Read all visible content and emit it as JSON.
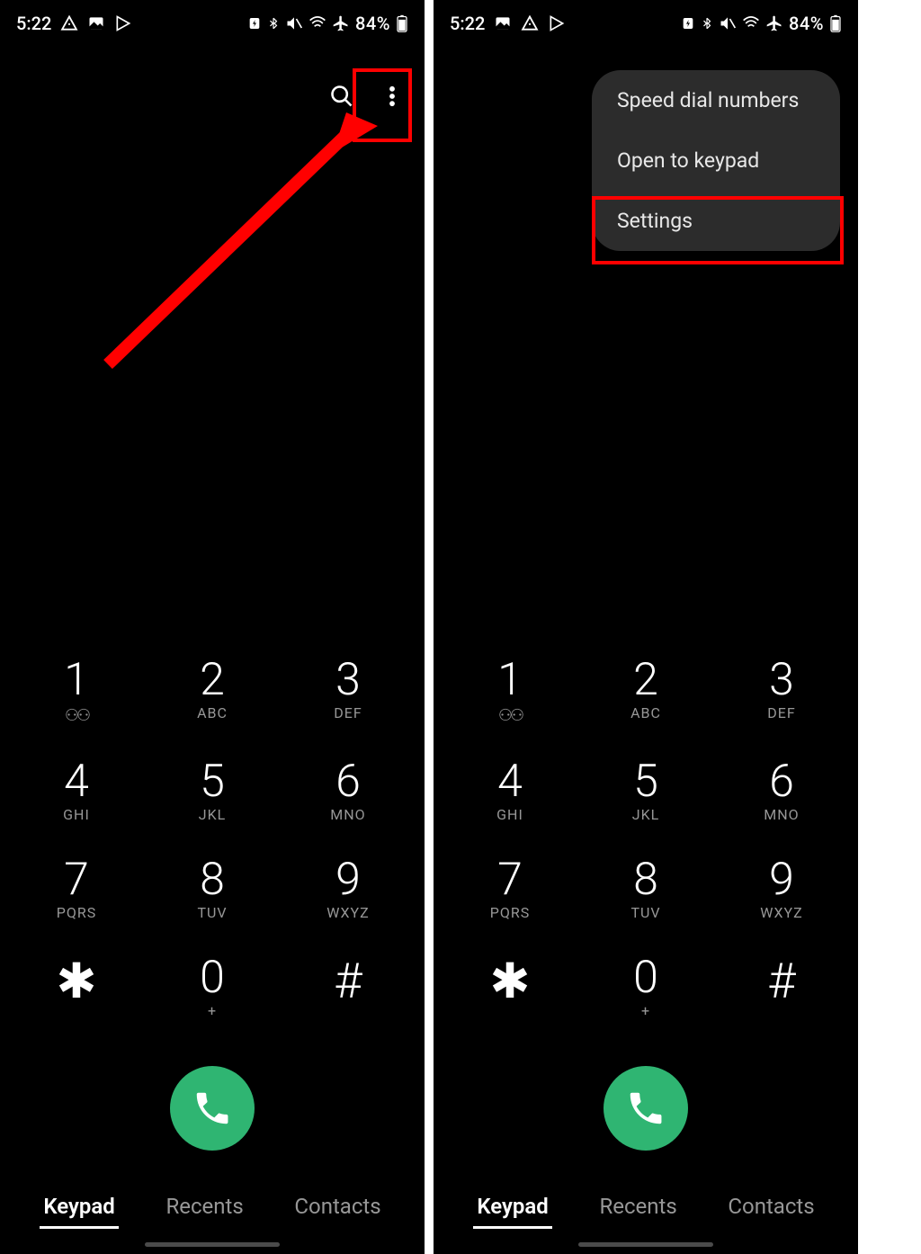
{
  "status_bar": {
    "time": "5:22",
    "battery_pct": "84%"
  },
  "keypad": {
    "keys": [
      {
        "digit": "1",
        "letters": ""
      },
      {
        "digit": "2",
        "letters": "ABC"
      },
      {
        "digit": "3",
        "letters": "DEF"
      },
      {
        "digit": "4",
        "letters": "GHI"
      },
      {
        "digit": "5",
        "letters": "JKL"
      },
      {
        "digit": "6",
        "letters": "MNO"
      },
      {
        "digit": "7",
        "letters": "PQRS"
      },
      {
        "digit": "8",
        "letters": "TUV"
      },
      {
        "digit": "9",
        "letters": "WXYZ"
      },
      {
        "digit": "*",
        "letters": ""
      },
      {
        "digit": "0",
        "letters": "+"
      },
      {
        "digit": "#",
        "letters": ""
      }
    ]
  },
  "tabs": {
    "keypad": "Keypad",
    "recents": "Recents",
    "contacts": "Contacts"
  },
  "menu": {
    "speed_dial": "Speed dial numbers",
    "open_keypad": "Open to keypad",
    "settings": "Settings"
  }
}
